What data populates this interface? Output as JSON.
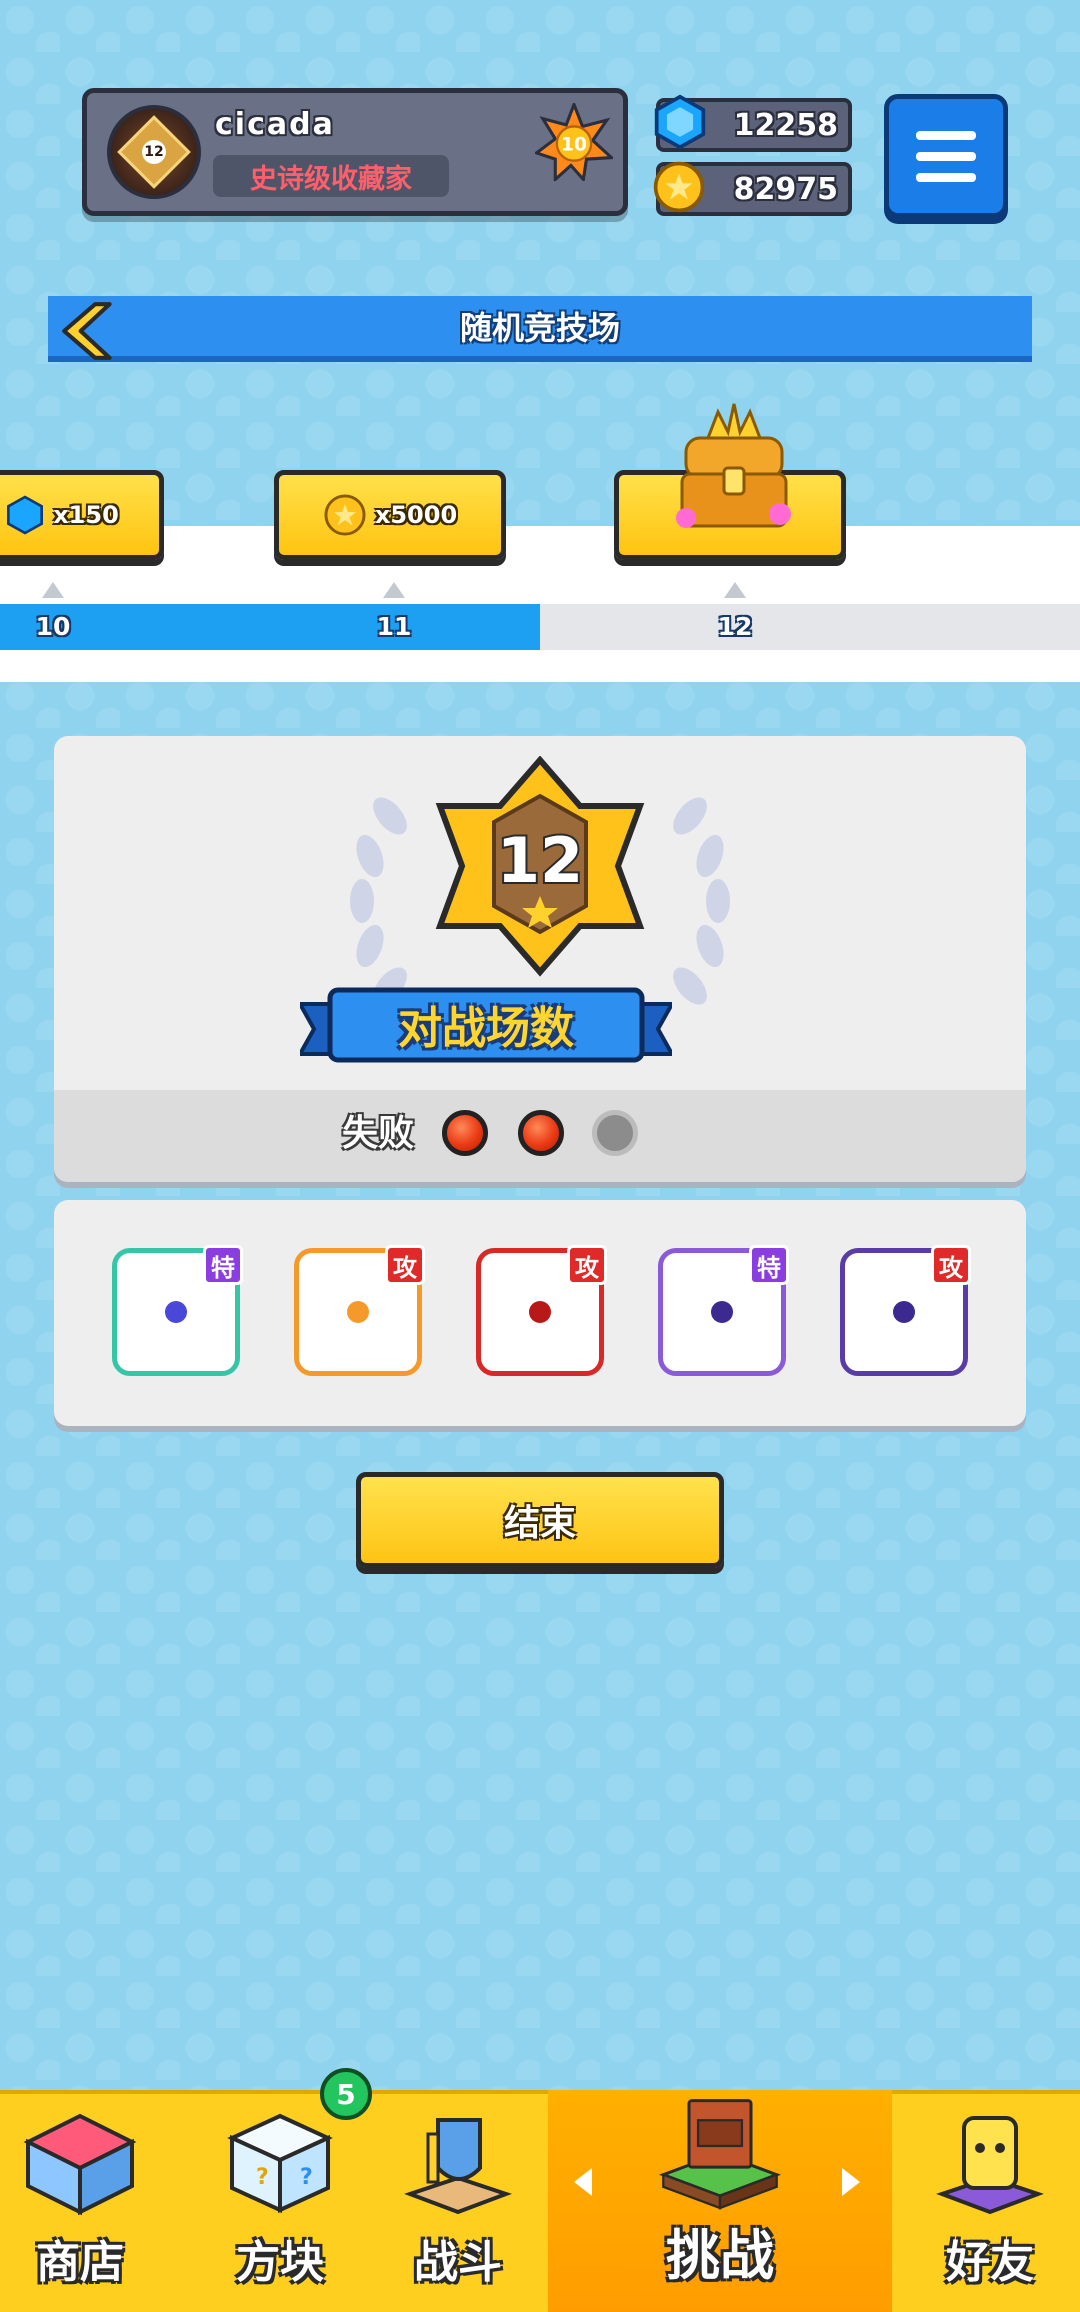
{
  "profile": {
    "username": "cicada",
    "title": "史诗级收藏家",
    "avatar_level": "12",
    "player_level": "10"
  },
  "currency": {
    "gems": "12258",
    "coins": "82975"
  },
  "header": {
    "title": "随机竞技场"
  },
  "track": {
    "rewards": [
      {
        "qty": "x150",
        "icon": "gem-icon"
      },
      {
        "qty": "x5000",
        "icon": "coin-icon"
      },
      {
        "qty": "",
        "icon": "treasure-chest-icon"
      }
    ],
    "ticks": [
      "10",
      "11",
      "12"
    ],
    "progress_fraction": 0.5
  },
  "battle": {
    "count": "12",
    "label": "对战场数",
    "loss_label": "失败",
    "losses": 2,
    "max_losses": 3
  },
  "deck": [
    {
      "tag": "特",
      "tag_color": "#8b3ee0",
      "border": "#35c6a8",
      "pip": "#4a48d8",
      "icon": "healing-hands-dice-icon"
    },
    {
      "tag": "攻",
      "tag_color": "#e02a2a",
      "border": "#f59a2a",
      "pip": "#f59a2a",
      "icon": "target-dice-icon"
    },
    {
      "tag": "攻",
      "tag_color": "#e02a2a",
      "border": "#d92828",
      "pip": "#b81818",
      "icon": "fire-dice-icon"
    },
    {
      "tag": "特",
      "tag_color": "#8b3ee0",
      "border": "#8a5ad8",
      "pip": "#3c2a90",
      "icon": "crack-dice-icon"
    },
    {
      "tag": "攻",
      "tag_color": "#e02a2a",
      "border": "#5a3ca8",
      "pip": "#3c2a90",
      "icon": "dragon-dice-icon"
    }
  ],
  "end_button": "结束",
  "nav": {
    "items": [
      {
        "label": "商店",
        "icon": "shop-icon"
      },
      {
        "label": "方块",
        "icon": "dice-box-icon",
        "badge": "5"
      },
      {
        "label": "战斗",
        "icon": "battle-shield-icon"
      },
      {
        "label": "挑战",
        "icon": "challenge-signboard-icon"
      },
      {
        "label": "好友",
        "icon": "friends-dice-icon"
      }
    ]
  },
  "colors": {
    "background": "#8fd3ee",
    "accent_blue": "#2d8ff0",
    "button_yellow": "#ffd12e",
    "nav_yellow": "#ffcf1f",
    "nav_active": "#ffa800"
  }
}
